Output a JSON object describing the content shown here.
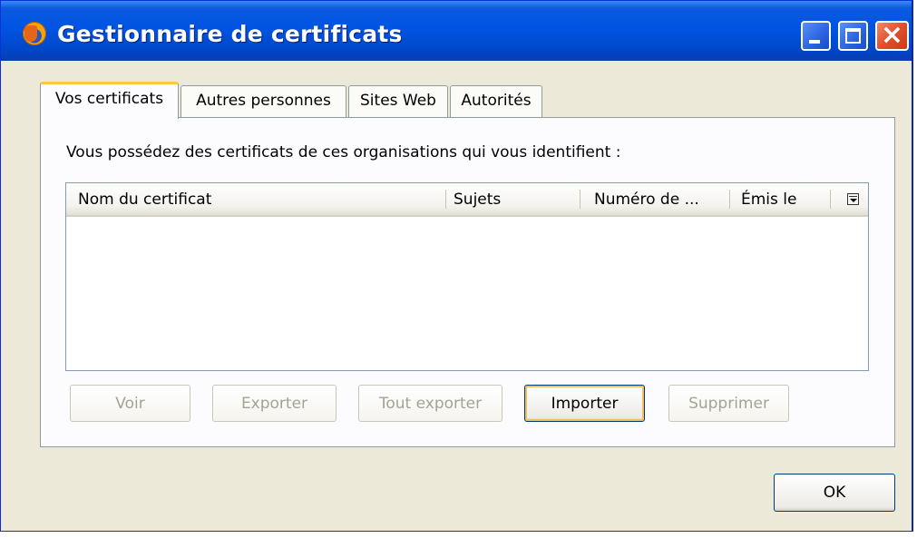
{
  "window": {
    "title": "Gestionnaire de certificats",
    "icon": "firefox-icon"
  },
  "tabs": [
    {
      "label": "Vos certificats",
      "active": true
    },
    {
      "label": "Autres personnes",
      "active": false
    },
    {
      "label": "Sites Web",
      "active": false
    },
    {
      "label": "Autorités",
      "active": false
    }
  ],
  "panel": {
    "description": "Vous possédez des certificats de ces organisations qui vous identifient :",
    "columns": [
      "Nom du certificat",
      "Sujets",
      "Numéro de ...",
      "Émis le"
    ],
    "rows": []
  },
  "buttons": {
    "view": "Voir",
    "export": "Exporter",
    "export_all": "Tout exporter",
    "import": "Importer",
    "delete": "Supprimer",
    "ok": "OK"
  },
  "colors": {
    "titlebar": "#0054e3",
    "window_bg": "#ece9d8",
    "active_tab_accent": "#ffc83c"
  }
}
